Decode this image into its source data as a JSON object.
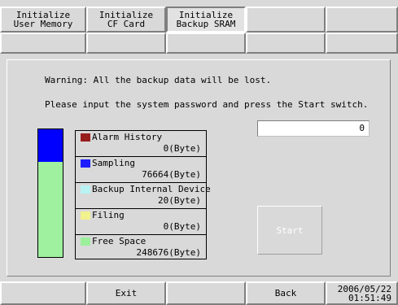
{
  "top_tabs": [
    {
      "line1": "Initialize",
      "line2": "User Memory"
    },
    {
      "line1": "Initialize",
      "line2": "CF Card"
    },
    {
      "line1": "Initialize",
      "line2": "Backup SRAM"
    }
  ],
  "messages": {
    "warning": "Warning: All the backup data will be lost.",
    "instruction": "Please input the system password and press the Start switch."
  },
  "legend": [
    {
      "name": "Alarm History",
      "value": "0(Byte)",
      "color": "#8b0000"
    },
    {
      "name": "Sampling",
      "value": "76664(Byte)",
      "color": "#0000ff"
    },
    {
      "name": "Backup Internal Device",
      "value": "20(Byte)",
      "color": "#b0f0f0"
    },
    {
      "name": "Filing",
      "value": "0(Byte)",
      "color": "#f0f080"
    },
    {
      "name": "Free Space",
      "value": "248676(Byte)",
      "color": "#90ee90"
    }
  ],
  "usage_bar": {
    "used_fraction": 0.255,
    "free_fraction": 0.745,
    "used_color": "#0000ff",
    "free_color": "#90ee90"
  },
  "password_field": {
    "value": "0"
  },
  "start_button": {
    "label": "Start"
  },
  "bottom_bar": {
    "exit_label": "Exit",
    "back_label": "Back",
    "date": "2006/05/22",
    "time": "01:51:49"
  }
}
